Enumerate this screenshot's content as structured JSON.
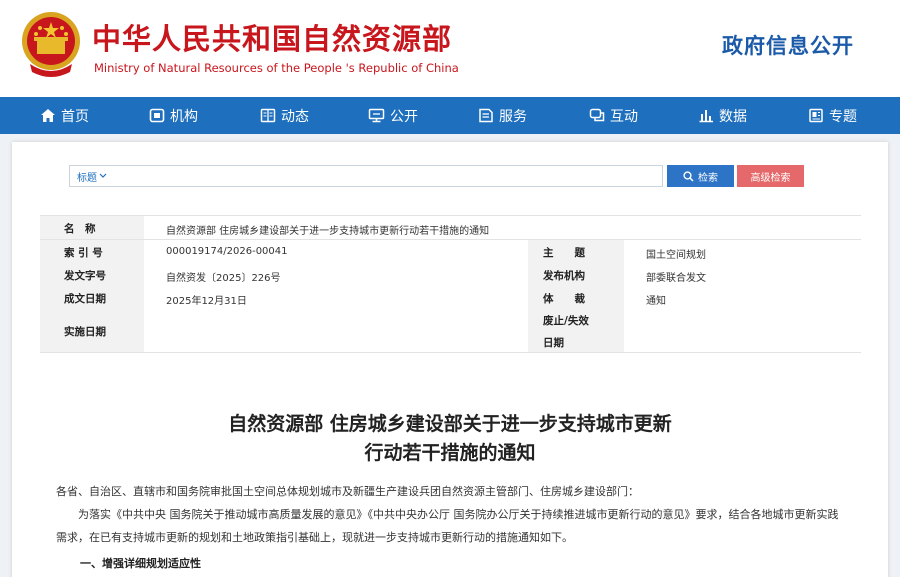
{
  "header": {
    "title_cn": "中华人民共和国自然资源部",
    "title_en": "Ministry of Natural Resources of the People 's Republic of China",
    "gov_info": "政府信息公开"
  },
  "nav": {
    "items": [
      {
        "label": "首页",
        "icon": "home-icon"
      },
      {
        "label": "机构",
        "icon": "org-icon"
      },
      {
        "label": "动态",
        "icon": "news-icon"
      },
      {
        "label": "公开",
        "icon": "open-icon"
      },
      {
        "label": "服务",
        "icon": "service-icon"
      },
      {
        "label": "互动",
        "icon": "chat-icon"
      },
      {
        "label": "数据",
        "icon": "chart-icon"
      },
      {
        "label": "专题",
        "icon": "topic-icon"
      }
    ]
  },
  "search": {
    "select_label": "标题",
    "placeholder": "",
    "search_label": "检索",
    "advanced_label": "高级检索"
  },
  "info": {
    "name_label": "名　称",
    "name_value": "自然资源部 住房城乡建设部关于进一步支持城市更新行动若干措施的通知",
    "index_label": "索 引 号",
    "index_value": "000019174/2026-00041",
    "subject_label": "主　　题",
    "subject_value": "国土空间规划",
    "doc_no_label": "发文字号",
    "doc_no_value": "自然资发〔2025〕226号",
    "issuer_label": "发布机构",
    "issuer_value": "部委联合发文",
    "date_label": "成文日期",
    "date_value": "2025年12月31日",
    "genre_label": "体　　裁",
    "genre_value": "通知",
    "effective_label": "实施日期",
    "effective_value": "",
    "expire_label_1": "废止/失效",
    "expire_label_2": "日期",
    "expire_value": ""
  },
  "article": {
    "title_line1": "自然资源部 住房城乡建设部关于进一步支持城市更新",
    "title_line2": "行动若干措施的通知",
    "salutation": "各省、自治区、直辖市和国务院审批国土空间总体规划城市及新疆生产建设兵团自然资源主管部门、住房城乡建设部门：",
    "para1": "为落实《中共中央 国务院关于推动城市高质量发展的意见》《中共中央办公厅 国务院办公厅关于持续推进城市更新行动的意见》要求，结合各地城市更新实践需求，在已有支持城市更新的规划和土地政策指引基础上，现就进一步支持城市更新行动的措施通知如下。",
    "section1": "一、增强详细规划适应性"
  },
  "colors": {
    "brand_red": "#c8161d",
    "nav_blue": "#1e6fbd",
    "search_blue": "#2d74c7",
    "adv_red": "#e5686a"
  }
}
